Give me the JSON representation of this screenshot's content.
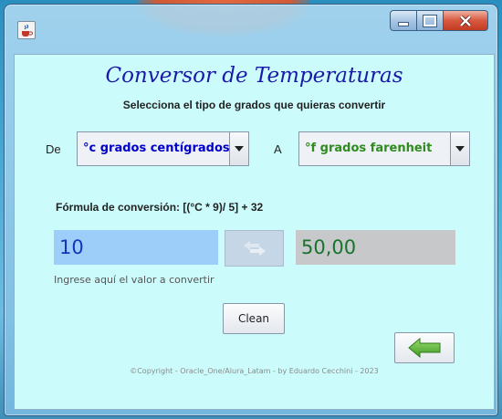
{
  "titlebar": {
    "icon": "java-coffee-icon",
    "buttons": [
      "minimize-icon",
      "maximize-icon",
      "close-icon"
    ]
  },
  "app": {
    "title": "Conversor de Temperaturas",
    "subtitle": "Selecciona el tipo de grados que quieras convertir",
    "from_label": "De",
    "from_selected": "°c grados centígrados",
    "to_label": "A",
    "to_selected": "°f grados farenheit",
    "formula": "Fórmula de conversión: [(°C * 9)/ 5] + 32",
    "input_value": "10",
    "output_value": "50,00",
    "input_hint": "Ingrese aquí el valor a convertir",
    "clean_label": "Clean",
    "copyright": "©Copyright - Oracle_One/Alura_Latam  - by Eduardo Cecchini - 2023"
  },
  "colors": {
    "panel_bg": "#ccfbfb",
    "title": "#1a1aa8",
    "from_text": "#0000cc",
    "to_text": "#2e8b1e",
    "input_bg": "#9dcdf9",
    "output_text": "#18732d",
    "back_arrow": "#5ab43a"
  }
}
